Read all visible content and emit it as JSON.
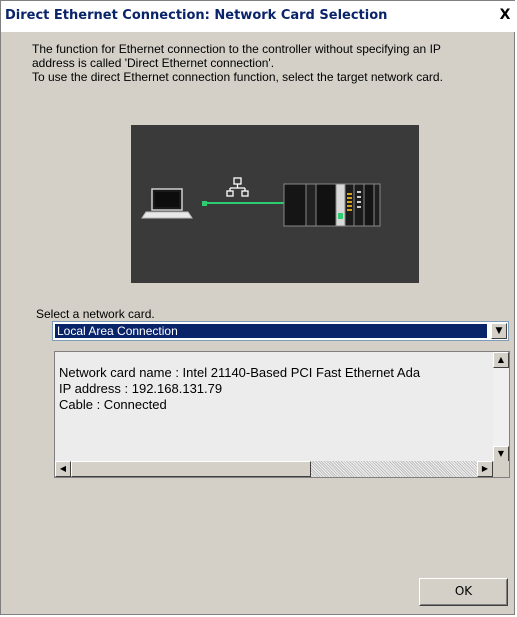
{
  "window": {
    "title": "Direct Ethernet Connection: Network Card Selection",
    "close_glyph": "X"
  },
  "description": [
    "The function for Ethernet connection to the controller without specifying an IP",
    "address is called 'Direct Ethernet connection'.",
    "To use the direct Ethernet connection function, select the target network card."
  ],
  "diagram": {
    "icons": [
      "laptop-icon",
      "network-icon",
      "controller-icon"
    ],
    "colors": {
      "background": "#3a3a3a",
      "cable": "#2ecc71"
    }
  },
  "select": {
    "label": "Select a network card.",
    "value": "Local Area Connection"
  },
  "info": {
    "lines": [
      "Network card name  : Intel 21140-Based PCI Fast Ethernet Ada",
      "IP address              : 192.168.131.79",
      "Cable      : Connected"
    ]
  },
  "buttons": {
    "ok": "OK"
  }
}
